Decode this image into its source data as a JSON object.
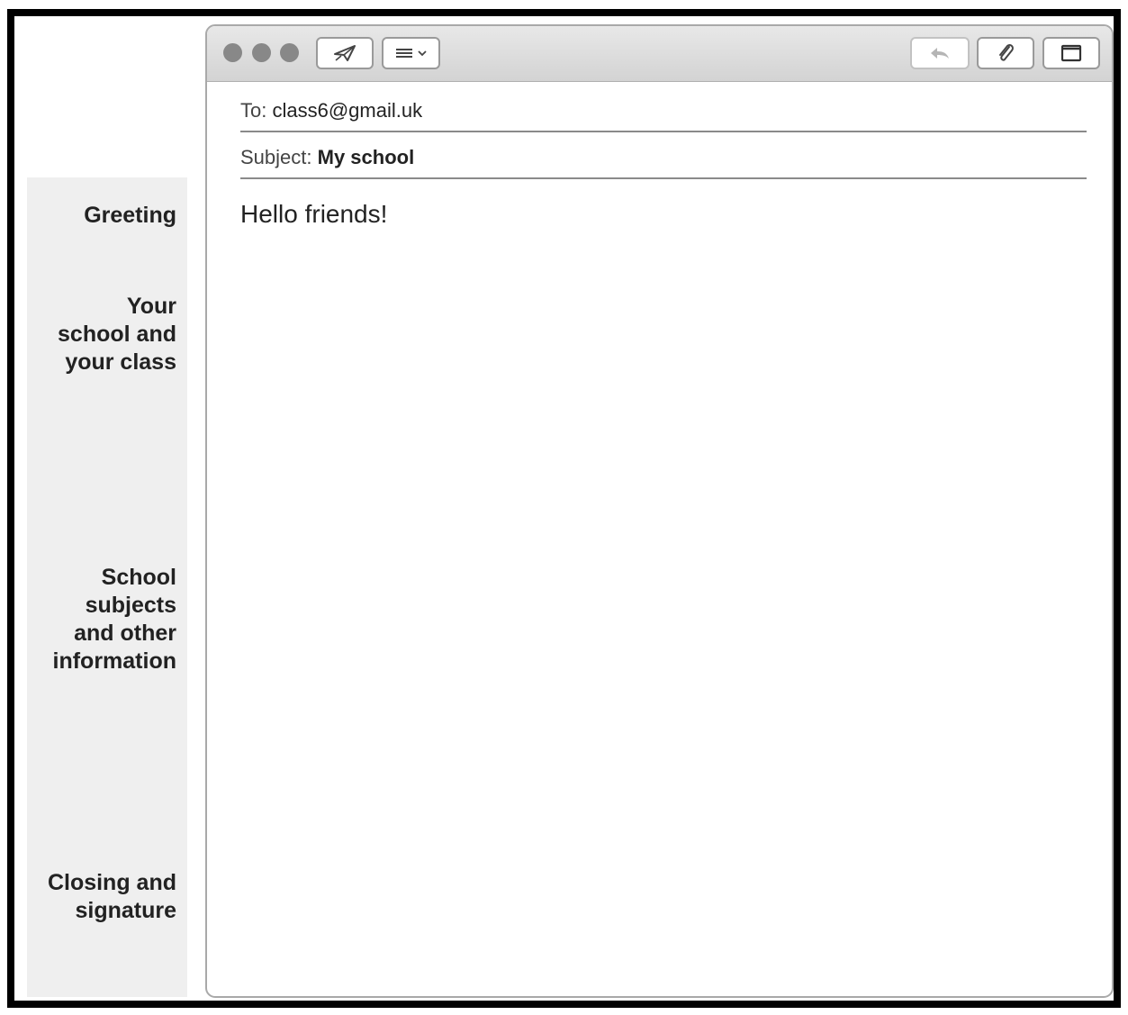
{
  "sidebar": {
    "labels": [
      "Greeting",
      "Your\nschool and\nyour class",
      "School\nsubjects\nand other\ninformation",
      "Closing and\nsignature"
    ]
  },
  "window": {
    "toolbar": {
      "icons": [
        "send-icon",
        "format-menu-icon",
        "chevron-down-icon",
        "reply-icon",
        "attach-icon",
        "window-icon"
      ]
    },
    "to": {
      "label": "To:",
      "value": "class6@gmail.uk"
    },
    "subject": {
      "label": "Subject:",
      "value": "My school"
    },
    "body": "Hello friends!"
  }
}
